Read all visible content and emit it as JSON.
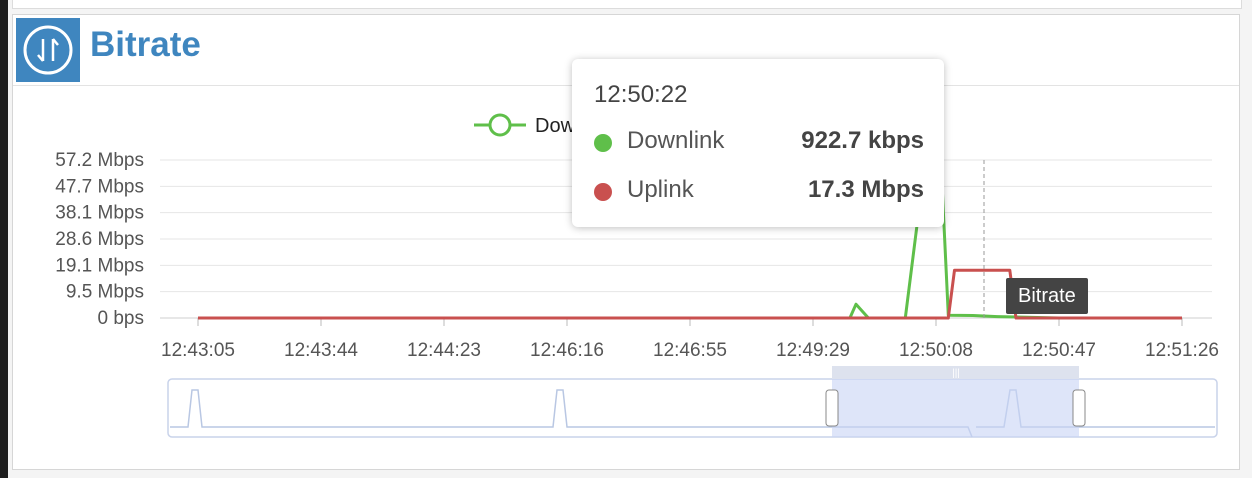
{
  "panel": {
    "title": "Bitrate",
    "icon": "up-down-arrows-icon"
  },
  "colors": {
    "downlink": "#5fbf4a",
    "uplink": "#c9504f",
    "accent": "#3f86bf"
  },
  "legend": {
    "visible_text": "Dow"
  },
  "tooltip": {
    "time": "12:50:22",
    "rows": [
      {
        "name": "Downlink",
        "value": "922.7 kbps"
      },
      {
        "name": "Uplink",
        "value": "17.3 Mbps"
      }
    ]
  },
  "hover_badge": "Bitrate",
  "chart_data": {
    "type": "line",
    "y_ticks": [
      "57.2 Mbps",
      "47.7 Mbps",
      "38.1 Mbps",
      "28.6 Mbps",
      "19.1 Mbps",
      "9.5 Mbps",
      "0 bps"
    ],
    "x_ticks": [
      "12:43:05",
      "12:43:44",
      "12:44:23",
      "12:46:16",
      "12:46:55",
      "12:49:29",
      "12:50:08",
      "12:50:47",
      "12:51:26"
    ],
    "ylim": [
      0,
      57.2
    ],
    "y_unit": "Mbps",
    "grid": true,
    "series": [
      {
        "name": "Downlink",
        "x": [
          0,
          1,
          2,
          3,
          4,
          4.6,
          5,
          5.3,
          5.35,
          5.45,
          5.5,
          5.6,
          5.75,
          5.85,
          6.0,
          6.05,
          6.1,
          6.3,
          6.5,
          7,
          8
        ],
        "values": [
          0,
          0,
          0,
          0,
          0,
          0,
          0,
          0,
          5,
          0,
          0,
          0,
          0,
          35,
          55,
          48,
          1,
          0.9,
          0.5,
          0,
          0
        ]
      },
      {
        "name": "Uplink",
        "x": [
          0,
          1,
          2,
          3,
          4,
          5,
          5.6,
          6.1,
          6.15,
          6.6,
          6.65,
          7,
          8
        ],
        "values": [
          0,
          0,
          0,
          0,
          0,
          0,
          0,
          0,
          17.3,
          17.3,
          0,
          0,
          0
        ]
      }
    ]
  }
}
